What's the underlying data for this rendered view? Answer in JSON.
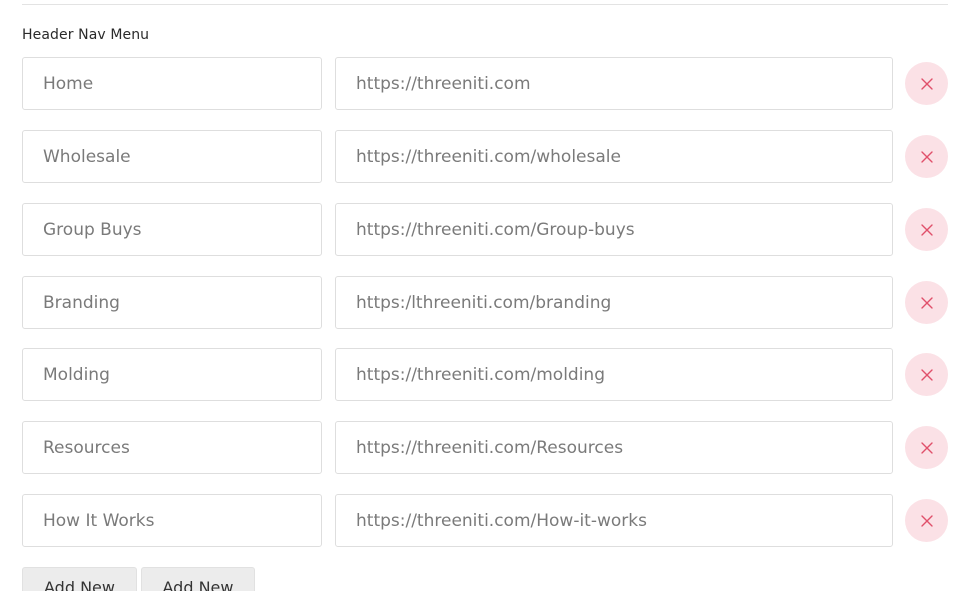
{
  "section": {
    "title": "Header Nav Menu"
  },
  "menu_items": [
    {
      "label": "Home",
      "url": "https://threeniti.com"
    },
    {
      "label": "Wholesale",
      "url": "https://threeniti.com/wholesale"
    },
    {
      "label": "Group Buys",
      "url": "https://threeniti.com/Group-buys"
    },
    {
      "label": "Branding",
      "url": "https:/lthreeniti.com/branding"
    },
    {
      "label": "Molding",
      "url": "https://threeniti.com/molding"
    },
    {
      "label": "Resources",
      "url": "https://threeniti.com/Resources"
    },
    {
      "label": "How It Works",
      "url": "https://threeniti.com/How-it-works"
    }
  ],
  "remove_icon": "close-icon",
  "buttons": {
    "add_new_1": "Add New",
    "add_new_2": "Add New"
  },
  "colors": {
    "remove_bg": "#fbe1e6",
    "remove_icon": "#e0506a",
    "field_text": "#7a7a7a",
    "field_border": "#dedede"
  }
}
